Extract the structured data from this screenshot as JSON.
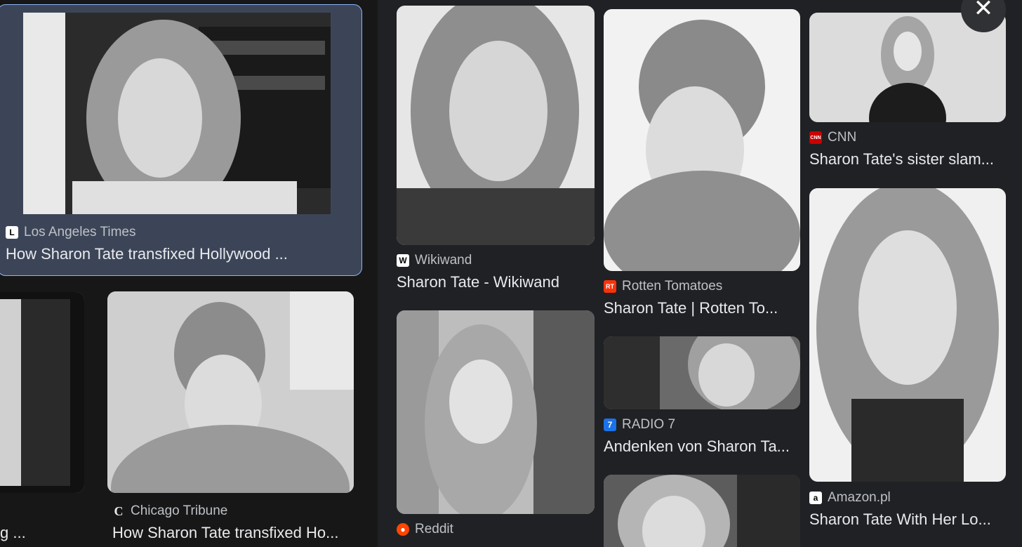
{
  "close_label": "✕",
  "cards": [
    {
      "source": "Los Angeles Times",
      "title": "How Sharon Tate transfixed Hollywood ...",
      "icon": "la-times-icon",
      "icon_char": "L",
      "icon_color": "#ffffff",
      "icon_fg": "#000000"
    },
    {
      "source": "",
      "title": "g ...",
      "icon": "",
      "icon_char": "",
      "icon_color": "",
      "icon_fg": ""
    },
    {
      "source": "Chicago Tribune",
      "title": "How Sharon Tate transfixed Ho...",
      "icon": "chicago-tribune-icon",
      "icon_char": "C",
      "icon_color": "#ffffff",
      "icon_fg": "#000000"
    },
    {
      "source": "Wikiwand",
      "title": "Sharon Tate - Wikiwand",
      "icon": "wikiwand-icon",
      "icon_char": "W",
      "icon_color": "#ffffff",
      "icon_fg": "#000000"
    },
    {
      "source": "Reddit",
      "title": "",
      "icon": "reddit-icon",
      "icon_char": "●",
      "icon_color": "#ff4500",
      "icon_fg": "#ffffff"
    },
    {
      "source": "Rotten Tomatoes",
      "title": "Sharon Tate | Rotten To...",
      "icon": "rotten-tomatoes-icon",
      "icon_char": "RT",
      "icon_color": "#fa320a",
      "icon_fg": "#ffffff"
    },
    {
      "source": "RADIO 7",
      "title": "Andenken von Sharon Ta...",
      "icon": "radio7-icon",
      "icon_char": "7",
      "icon_color": "#1a73e8",
      "icon_fg": "#ffffff"
    },
    {
      "source": "CNN",
      "title": "Sharon Tate's sister slam...",
      "icon": "cnn-icon",
      "icon_char": "CNN",
      "icon_color": "#cc0000",
      "icon_fg": "#ffffff"
    },
    {
      "source": "Amazon.pl",
      "title": "Sharon Tate With Her Lo...",
      "icon": "amazon-icon",
      "icon_char": "a",
      "icon_color": "#ffffff",
      "icon_fg": "#000000"
    }
  ]
}
